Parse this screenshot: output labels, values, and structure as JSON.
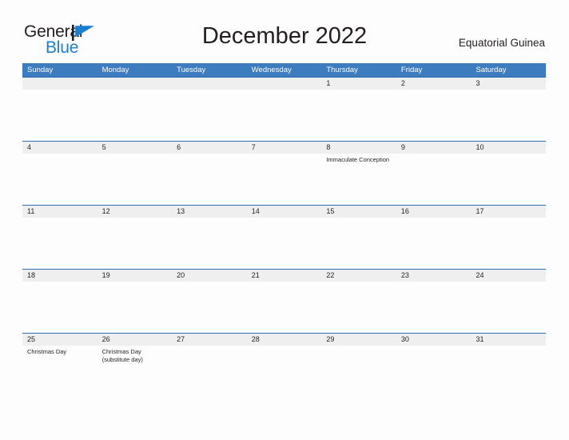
{
  "brand": {
    "name_part1": "General",
    "name_part2": "Blue",
    "accent_color": "#1b7fd1"
  },
  "header": {
    "title": "December 2022",
    "country": "Equatorial Guinea"
  },
  "theme": {
    "header_blue": "#3d7cbe",
    "rule_blue": "#2c6fb0",
    "datebar_gray": "#efefef",
    "text": "#231f20"
  },
  "calendar": {
    "weekdays": [
      "Sunday",
      "Monday",
      "Tuesday",
      "Wednesday",
      "Thursday",
      "Friday",
      "Saturday"
    ],
    "weeks": [
      {
        "days": [
          {
            "num": "",
            "event": ""
          },
          {
            "num": "",
            "event": ""
          },
          {
            "num": "",
            "event": ""
          },
          {
            "num": "",
            "event": ""
          },
          {
            "num": "1",
            "event": ""
          },
          {
            "num": "2",
            "event": ""
          },
          {
            "num": "3",
            "event": ""
          }
        ]
      },
      {
        "days": [
          {
            "num": "4",
            "event": ""
          },
          {
            "num": "5",
            "event": ""
          },
          {
            "num": "6",
            "event": ""
          },
          {
            "num": "7",
            "event": ""
          },
          {
            "num": "8",
            "event": "Immaculate Conception"
          },
          {
            "num": "9",
            "event": ""
          },
          {
            "num": "10",
            "event": ""
          }
        ]
      },
      {
        "days": [
          {
            "num": "11",
            "event": ""
          },
          {
            "num": "12",
            "event": ""
          },
          {
            "num": "13",
            "event": ""
          },
          {
            "num": "14",
            "event": ""
          },
          {
            "num": "15",
            "event": ""
          },
          {
            "num": "16",
            "event": ""
          },
          {
            "num": "17",
            "event": ""
          }
        ]
      },
      {
        "days": [
          {
            "num": "18",
            "event": ""
          },
          {
            "num": "19",
            "event": ""
          },
          {
            "num": "20",
            "event": ""
          },
          {
            "num": "21",
            "event": ""
          },
          {
            "num": "22",
            "event": ""
          },
          {
            "num": "23",
            "event": ""
          },
          {
            "num": "24",
            "event": ""
          }
        ]
      },
      {
        "days": [
          {
            "num": "25",
            "event": "Christmas Day"
          },
          {
            "num": "26",
            "event": "Christmas Day (substitute day)"
          },
          {
            "num": "27",
            "event": ""
          },
          {
            "num": "28",
            "event": ""
          },
          {
            "num": "29",
            "event": ""
          },
          {
            "num": "30",
            "event": ""
          },
          {
            "num": "31",
            "event": ""
          }
        ]
      }
    ]
  }
}
